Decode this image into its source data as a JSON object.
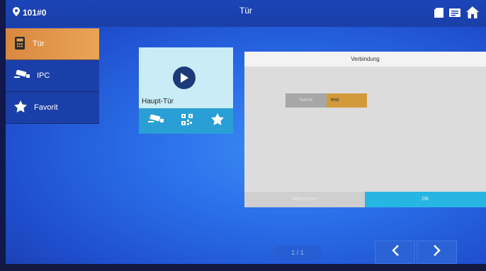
{
  "header": {
    "room": "101#0",
    "title": "Tür"
  },
  "sidebar": {
    "items": [
      {
        "label": "Tür",
        "icon": "door-panel-icon",
        "active": true
      },
      {
        "label": "IPC",
        "icon": "cctv-camera-icon",
        "active": false
      },
      {
        "label": "Favorit",
        "icon": "star-icon",
        "active": false
      }
    ]
  },
  "door_card": {
    "name": "Haupt-Tür"
  },
  "dialog": {
    "title": "Verbindung",
    "name_label": "Name",
    "name_value": "test",
    "cancel_label": "Abbrechen",
    "ok_label": "OK"
  },
  "pager": {
    "page": "1 / 1"
  },
  "colors": {
    "accent_orange": "#d9883f",
    "dialog_ok": "#27b6e3",
    "card": "#c9ecf7"
  }
}
